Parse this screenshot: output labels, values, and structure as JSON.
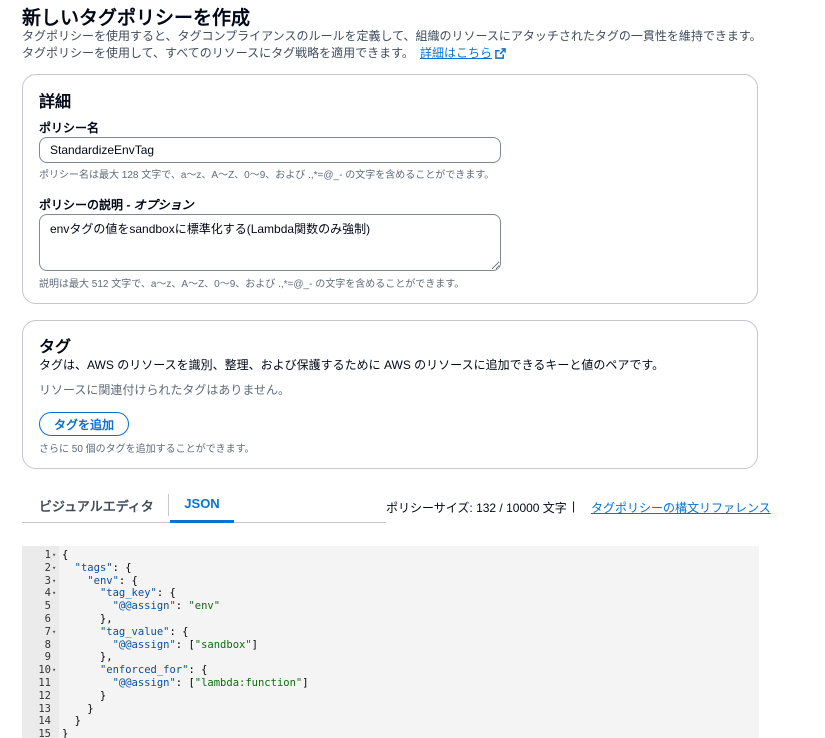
{
  "header": {
    "title": "新しいタグポリシーを作成",
    "description": "タグポリシーを使用すると、タグコンプライアンスのルールを定義して、組織のリソースにアタッチされたタグの一貫性を維持できます。タグポリシーを使用して、すべてのリソースにタグ戦略を適用できます。",
    "learn_more": "詳細はこちら",
    "learn_more_icon": "external-link-icon"
  },
  "details": {
    "title": "詳細",
    "policy_name_label": "ポリシー名",
    "policy_name_value": "StandardizeEnvTag",
    "policy_name_hint": "ポリシー名は最大 128 文字で、a〜z、A〜Z、0〜9、および .,*=@_- の文字を含めることができます。",
    "description_label": "ポリシーの説明",
    "description_optional": " - オプション",
    "description_value": "envタグの値をsandboxに標準化する(Lambda関数のみ強制)",
    "description_hint": "説明は最大 512 文字で、a〜z、A〜Z、0〜9、および .,*=@_- の文字を含めることができます。"
  },
  "tags_section": {
    "title": "タグ",
    "description": "タグは、AWS のリソースを識別、整理、および保護するために AWS のリソースに追加できるキーと値のペアです。",
    "empty_text": "リソースに関連付けられたタグはありません。",
    "add_button": "タグを追加",
    "limit_text": "さらに 50 個のタグを追加することができます。"
  },
  "editor_tabs": {
    "visual": "ビジュアルエディタ",
    "json": "JSON",
    "active": "JSON"
  },
  "policy_size": "ポリシーサイズ: 132 / 10000 文字",
  "separator": "|",
  "syntax_reference": "タグポリシーの構文リファレンス",
  "code_lines": [
    {
      "n": "1",
      "fold": true,
      "text": "{"
    },
    {
      "n": "2",
      "fold": true,
      "text": "  \"tags\": {"
    },
    {
      "n": "3",
      "fold": true,
      "text": "    \"env\": {"
    },
    {
      "n": "4",
      "fold": true,
      "text": "      \"tag_key\": {"
    },
    {
      "n": "5",
      "fold": false,
      "text": "        \"@@assign\": \"env\""
    },
    {
      "n": "6",
      "fold": false,
      "text": "      },"
    },
    {
      "n": "7",
      "fold": true,
      "text": "      \"tag_value\": {"
    },
    {
      "n": "8",
      "fold": false,
      "text": "        \"@@assign\": [\"sandbox\"]"
    },
    {
      "n": "9",
      "fold": false,
      "text": "      },"
    },
    {
      "n": "10",
      "fold": true,
      "text": "      \"enforced_for\": {"
    },
    {
      "n": "11",
      "fold": false,
      "text": "        \"@@assign\": [\"lambda:function\"]"
    },
    {
      "n": "12",
      "fold": false,
      "text": "      }"
    },
    {
      "n": "13",
      "fold": false,
      "text": "    }"
    },
    {
      "n": "14",
      "fold": false,
      "text": "  }"
    },
    {
      "n": "15",
      "fold": false,
      "text": "}"
    }
  ],
  "colors": {
    "link": "#0972d3",
    "text": "#000716",
    "muted": "#5f6b7a",
    "border": "#c6c6cd"
  }
}
